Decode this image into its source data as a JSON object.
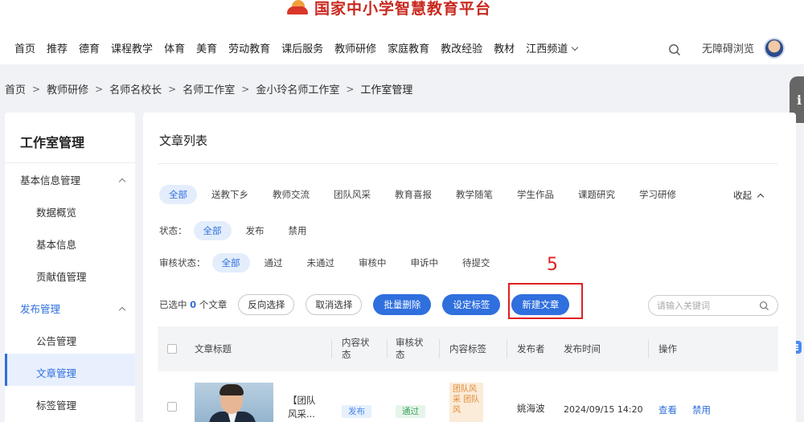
{
  "header": {
    "logo_text": "国家中小学智慧教育平台",
    "nav": [
      "首页",
      "推荐",
      "德育",
      "课程教学",
      "体育",
      "美育",
      "劳动教育",
      "课后服务",
      "教师研修",
      "家庭教育",
      "教改经验",
      "教材",
      "江西频道"
    ],
    "accessible_label": "无障碍浏览"
  },
  "breadcrumb": [
    "首页",
    "教师研修",
    "名师名校长",
    "名师工作室",
    "金小玲名师工作室",
    "工作室管理"
  ],
  "sidebar": {
    "title": "工作室管理",
    "group1": {
      "label": "基本信息管理",
      "items": [
        "数据概览",
        "基本信息",
        "贡献值管理"
      ]
    },
    "group2": {
      "label": "发布管理",
      "items": [
        "公告管理",
        "文章管理",
        "标签管理"
      ]
    }
  },
  "main": {
    "title": "文章列表",
    "categories": [
      "全部",
      "送教下乡",
      "教师交流",
      "团队风采",
      "教育喜报",
      "教学随笔",
      "学生作品",
      "课题研究",
      "学习研修"
    ],
    "collapse_label": "收起",
    "status": {
      "label": "状态：",
      "options": [
        "全部",
        "发布",
        "禁用"
      ]
    },
    "review": {
      "label": "审核状态：",
      "options": [
        "全部",
        "通过",
        "未通过",
        "审核中",
        "申诉中",
        "待提交"
      ]
    },
    "annotation": "5",
    "selection": {
      "prefix": "已选中",
      "count": "0",
      "suffix": "个文章"
    },
    "buttons": {
      "invert": "反向选择",
      "cancel": "取消选择",
      "batch_delete": "批量删除",
      "set_tag": "设定标签",
      "new_article": "新建文章"
    },
    "search_placeholder": "请输入关键词",
    "table": {
      "headers": [
        "文章标题",
        "内容状态",
        "审核状态",
        "内容标签",
        "发布者",
        "发布时间",
        "操作"
      ],
      "rows": [
        {
          "title": "【团队风采...",
          "content_status": "发布",
          "review_status": "通过",
          "tags": "团队风采 团队风",
          "publisher": "姚海波",
          "time": "2024/09/15 14:20",
          "action_view": "查看",
          "action_disable": "禁用"
        }
      ]
    }
  },
  "colors": {
    "accent": "#2f6fde",
    "annotation": "#e02020",
    "brand": "#c8281f"
  }
}
